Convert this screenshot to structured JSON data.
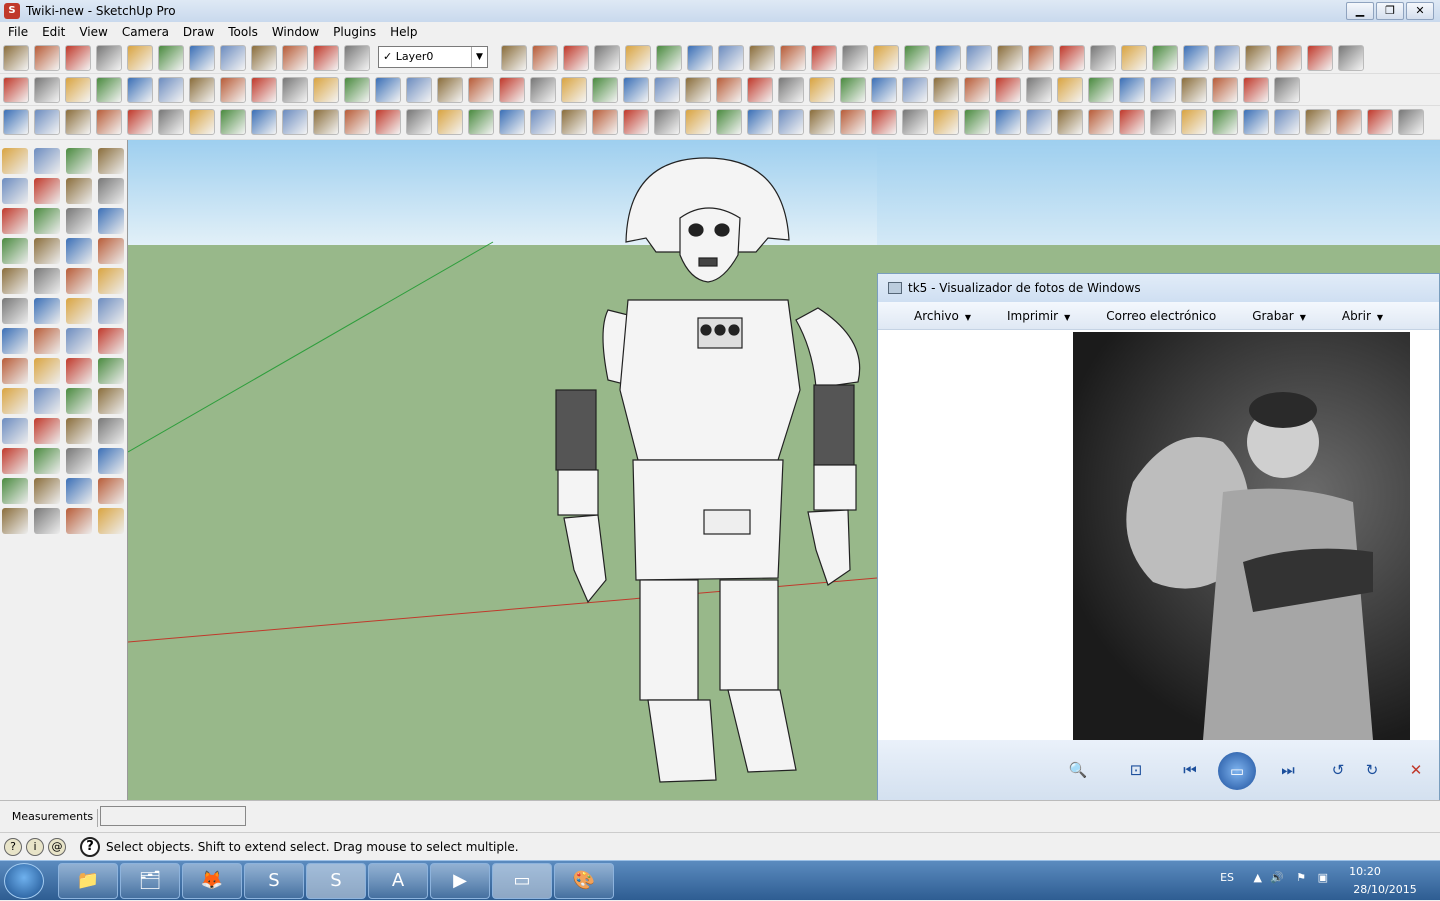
{
  "window": {
    "title": "Twiki-new - SketchUp Pro",
    "app_icon": "sketchup-icon"
  },
  "menu": [
    "File",
    "Edit",
    "View",
    "Camera",
    "Draw",
    "Tools",
    "Window",
    "Plugins",
    "Help"
  ],
  "layer": {
    "value": "Layer0",
    "checked": true
  },
  "viewer": {
    "title": "tk5 - Visualizador de fotos de Windows",
    "menu": [
      "Archivo",
      "Imprimir",
      "Correo electrónico",
      "Grabar",
      "Abrir"
    ],
    "menu_has_caret": [
      true,
      true,
      false,
      true,
      true
    ],
    "controls": [
      "zoom-icon",
      "actual-size-icon",
      "previous-icon",
      "slideshow-icon",
      "next-icon",
      "rotate-left-icon",
      "rotate-right-icon",
      "delete-icon"
    ]
  },
  "measurements": {
    "label": "Measurements",
    "value": ""
  },
  "status": {
    "message": "Select objects. Shift to extend select. Drag mouse to select multiple."
  },
  "taskbar": {
    "apps": [
      "windows-explorer-folder",
      "file-manager",
      "firefox",
      "skype",
      "sketchup",
      "layout",
      "media-player",
      "photo-viewer",
      "paint"
    ],
    "language": "ES",
    "time": "10:20",
    "date": "28/10/2015"
  },
  "colors": {
    "sky": "#9ecfef",
    "ground": "#98b88a",
    "red_axis": "#c0392b",
    "green_axis": "#2e9e3c",
    "accent": "#1c4f9c"
  }
}
